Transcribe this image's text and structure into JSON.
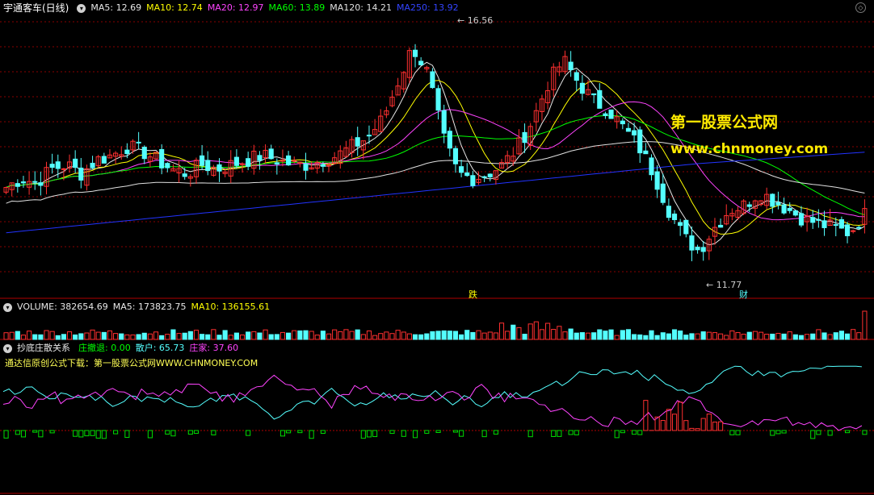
{
  "header": {
    "stock_title": "宇通客车(日线)",
    "ma5": "MA5: 12.69",
    "ma10": "MA10: 12.74",
    "ma20": "MA20: 12.97",
    "ma60": "MA60: 13.89",
    "ma120": "MA120: 14.21",
    "ma250": "MA250: 13.92"
  },
  "volume_panel": {
    "volume": "VOLUME: 382654.69",
    "ma5": "MA5: 173823.75",
    "ma10": "MA10: 136155.61"
  },
  "indicator_panel": {
    "name": "抄底庄散关系",
    "zhuang_tui": "庄撤退: 0.00",
    "san_hu": "散户: 65.73",
    "zhuang_jia": "庄家: 37.60",
    "note": "通达信原创公式下载：第一股票公式网WWW.CHNMONEY.COM"
  },
  "watermark": {
    "line1": "第一股票公式网",
    "line2": "www.chnmoney.com"
  },
  "annotations": {
    "high_label": "16.56",
    "low_label": "11.77",
    "event_die": "跌",
    "event_cai": "财"
  },
  "colors": {
    "up": "#ff3030",
    "down": "#54ffff",
    "ma5": "#e8e8e8",
    "ma10": "#ffff00",
    "ma20": "#ff44ff",
    "ma60": "#00ff00",
    "ma120": "#e0e0e0",
    "ma250": "#2233ff"
  },
  "chart_data": {
    "type": "candlestick",
    "price_range": [
      11.0,
      17.1
    ],
    "high": 16.56,
    "low": 11.77,
    "close_path": [
      13.3,
      13.5,
      13.4,
      13.7,
      13.8,
      13.6,
      13.9,
      14.0,
      14.2,
      14.1,
      13.9,
      13.7,
      13.6,
      13.8,
      13.7,
      13.8,
      13.9,
      14.0,
      13.9,
      13.8,
      13.8,
      13.9,
      14.0,
      14.2,
      14.4,
      14.8,
      15.6,
      16.4,
      15.8,
      14.4,
      13.6,
      13.5,
      13.6,
      13.8,
      14.2,
      14.8,
      15.6,
      16.1,
      15.6,
      15.2,
      15.0,
      14.6,
      14.2,
      13.6,
      12.8,
      12.2,
      11.9,
      12.4,
      12.8,
      12.9,
      13.2,
      13.0,
      12.8,
      12.6,
      12.5,
      12.4,
      12.3,
      12.7
    ],
    "ma_values": {
      "MA5": 12.69,
      "MA10": 12.74,
      "MA20": 12.97,
      "MA60": 13.89,
      "MA120": 14.21,
      "MA250": 13.92
    },
    "volume": {
      "VOLUME": 382654.69,
      "MA5": 173823.75,
      "MA10": 136155.61
    },
    "indicator": {
      "庄撤退": 0.0,
      "散户": 65.73,
      "庄家": 37.6
    }
  }
}
